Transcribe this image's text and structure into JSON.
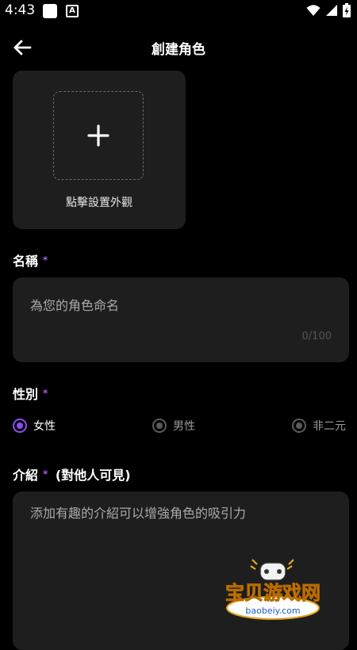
{
  "status_bar": {
    "time": "4:43",
    "notif_badge": "A"
  },
  "header": {
    "title": "創建角色"
  },
  "avatar": {
    "label": "點擊設置外觀"
  },
  "name_section": {
    "label": "名稱",
    "required_mark": "*",
    "placeholder": "為您的角色命名",
    "counter": "0/100"
  },
  "gender_section": {
    "label": "性別",
    "required_mark": "*",
    "options": [
      {
        "label": "女性",
        "selected": true
      },
      {
        "label": "男性",
        "selected": false
      },
      {
        "label": "非二元",
        "selected": false
      }
    ]
  },
  "intro_section": {
    "label": "介紹",
    "required_mark": "*",
    "note": "(對他人可見)",
    "placeholder": "添加有趣的介紹可以增強角色的吸引力"
  },
  "watermark": {
    "text": "宝贝游戏网",
    "url": "baobeiy.com"
  },
  "colors": {
    "accent": "#8e4cf2",
    "required_star": "#9b5cf6",
    "card": "#1e1e1e",
    "background": "#000000"
  }
}
